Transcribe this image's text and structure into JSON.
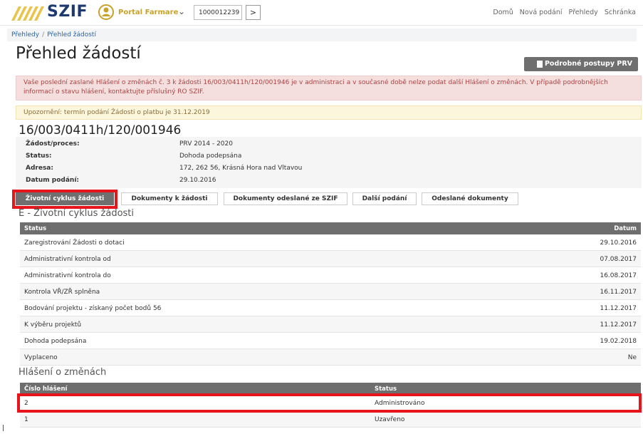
{
  "header": {
    "logo_text": "SZIF",
    "portal_label": "Portal Farmare",
    "id_value": "1000012239",
    "go_label": ">",
    "links": [
      "Domů",
      "Nová podání",
      "Přehledy",
      "Schránka"
    ]
  },
  "breadcrumb": [
    "Přehledy",
    "Přehled žádostí"
  ],
  "page_title": "Přehled žádostí",
  "prv_button": "Podrobné postupy PRV",
  "alert_danger": "Vaše poslední zaslané Hlášení o změnách č. 3 k žádosti 16/003/0411h/120/001946 je v administraci a v současné době nelze podat další Hlášení o změnách. V případě podrobnějších informací o stavu hlášení, kontaktujte příslušný RO SZIF.",
  "alert_warning": "Upozornění: termín podání Žádosti o platbu je 31.12.2019",
  "application_number": "16/003/0411h/120/001946",
  "details": [
    {
      "label": "Žádost/proces:",
      "value": "PRV 2014 - 2020"
    },
    {
      "label": "Status:",
      "value": "Dohoda podepsána"
    },
    {
      "label": "Adresa:",
      "value": "172, 262 56, Krásná Hora nad Vltavou"
    },
    {
      "label": "Datum podání:",
      "value": "29.10.2016"
    }
  ],
  "tabs": [
    "Životní cyklus žádosti",
    "Dokumenty k žádosti",
    "Dokumenty odeslané ze SZIF",
    "Další podání",
    "Odeslané dokumenty"
  ],
  "lifecycle": {
    "title": "E - Životní cyklus žádosti",
    "col_status": "Status",
    "col_date": "Datum",
    "rows": [
      {
        "status": "Zaregistrování Žádosti o dotaci",
        "date": "29.10.2016"
      },
      {
        "status": "Administrativní kontrola od",
        "date": "07.08.2017"
      },
      {
        "status": "Administrativní kontrola do",
        "date": "16.08.2017"
      },
      {
        "status": "Kontrola VŘ/ZŘ splněna",
        "date": "16.11.2017"
      },
      {
        "status": "Bodování projektu - získaný počet bodů 56",
        "date": "11.12.2017"
      },
      {
        "status": "K výběru projektů",
        "date": "11.12.2017"
      },
      {
        "status": "Dohoda podepsána",
        "date": "19.02.2018"
      },
      {
        "status": "Vyplaceno",
        "date": "Ne"
      }
    ]
  },
  "changes": {
    "title": "Hlášení o změnách",
    "col_number": "Číslo hlášení",
    "col_status": "Status",
    "rows": [
      {
        "number": "2",
        "status": "Administrováno"
      },
      {
        "number": "1",
        "status": "Uzavřeno"
      }
    ]
  },
  "colors": {
    "highlight": "#e8141b",
    "brand": "#1d3a6e",
    "portal": "#c8a228",
    "table_header": "#6e6e6e"
  }
}
